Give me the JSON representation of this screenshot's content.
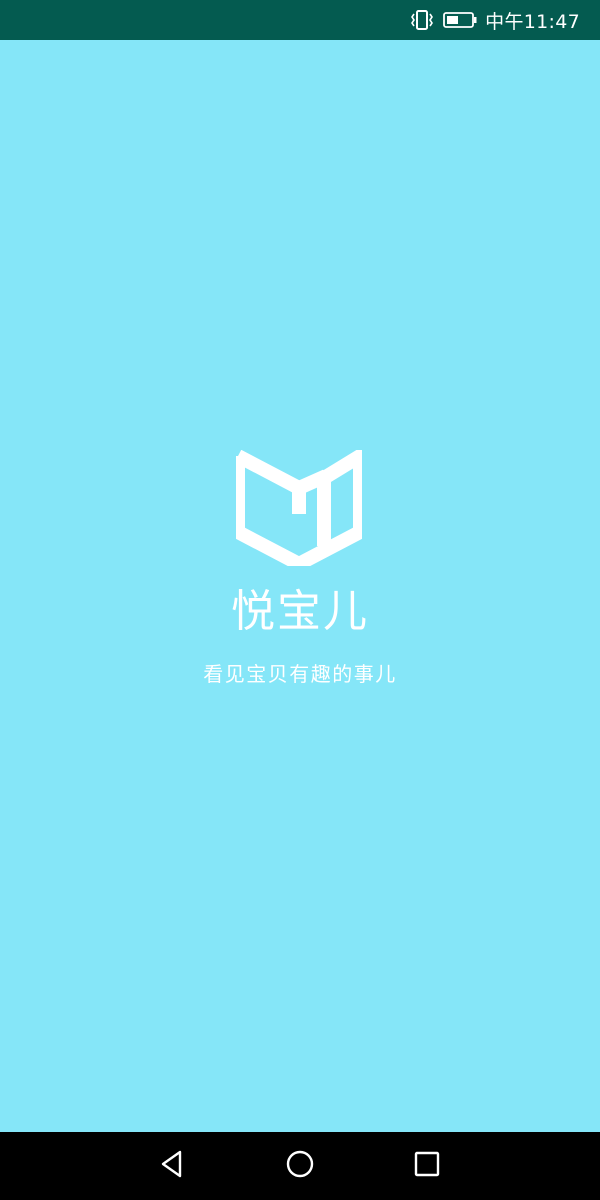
{
  "status_bar": {
    "time": "中午11:47",
    "icons": [
      "vibrate-icon",
      "battery-icon"
    ],
    "background_color": "#045b50"
  },
  "splash": {
    "background_color": "#85e6f8",
    "logo_icon": "open-book-logo-icon",
    "brand_name": "悦宝儿",
    "tagline": "看见宝贝有趣的事儿"
  },
  "nav_bar": {
    "buttons": [
      "back-icon",
      "home-icon",
      "recents-icon"
    ]
  }
}
